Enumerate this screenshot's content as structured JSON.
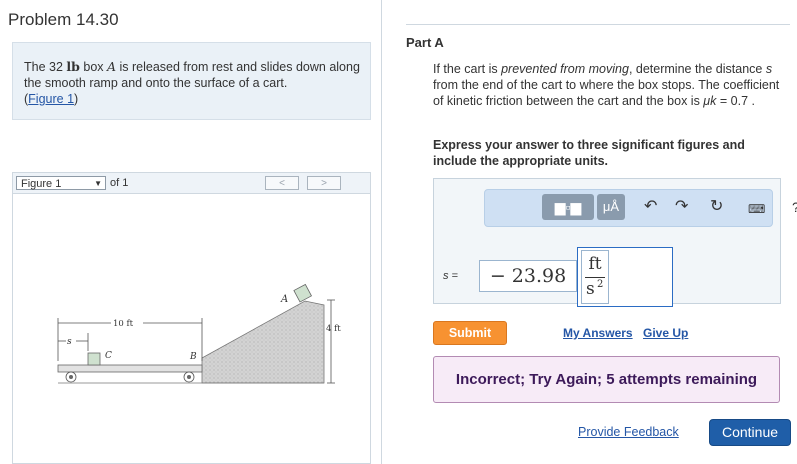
{
  "problem": {
    "title": "Problem 14.30",
    "text_pre": "The 32 ",
    "unit_lb": "lb",
    "text_mid": " box ",
    "var_A": "A",
    "text_post": " is released from rest and slides down along the smooth ramp and onto the surface of a cart.",
    "figure_link": "Figure 1"
  },
  "figure": {
    "select_value": "Figure 1",
    "of_label": "of 1",
    "prev": "<",
    "next": ">",
    "labels": {
      "A": "A",
      "C": "C",
      "B": "B",
      "s": "s",
      "dist": "10 ft",
      "height": "4 ft"
    }
  },
  "part": {
    "title": "Part A",
    "q1": "If the cart is ",
    "q_italic": "prevented from moving",
    "q2": ", determine the distance ",
    "q_var_s": "s",
    "q3": " from the end of the cart to where the box stops. The coefficient of kinetic friction between the cart and the box is ",
    "q_mu": "μk",
    "q4": " = 0.7 .",
    "instruction": "Express your answer to three significant figures and include the appropriate units."
  },
  "toolbar": {
    "units_btn": "μÅ",
    "help": "?"
  },
  "answer": {
    "var_label": "s =",
    "value": "− 23.98",
    "unit_num": "ft",
    "unit_den": "s",
    "unit_exp": "2"
  },
  "actions": {
    "submit": "Submit",
    "my_answers": "My Answers",
    "give_up": "Give Up"
  },
  "feedback": {
    "message": "Incorrect; Try Again; 5 attempts remaining"
  },
  "footer": {
    "provide_feedback": "Provide Feedback",
    "continue": "Continue"
  }
}
